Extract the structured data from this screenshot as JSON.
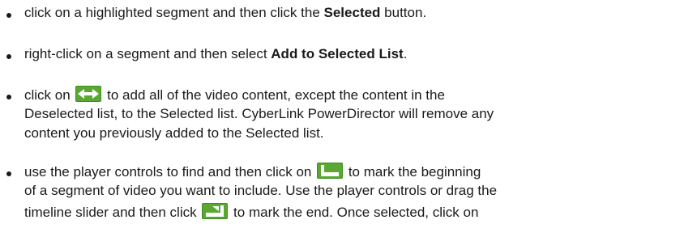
{
  "items": [
    {
      "pre": "click on a highlighted segment and then click the ",
      "bold": "Selected",
      "post": " button."
    },
    {
      "pre": "right-click on a segment and then select ",
      "bold": "Add to Selected List",
      "post": "."
    },
    {
      "line1_pre": "click on ",
      "line1_post": " to add all of the video content, except the content in the",
      "line2": "Deselected list, to the Selected list. CyberLink PowerDirector will remove any",
      "line3": "content you previously added to the Selected list."
    },
    {
      "line1_pre": "use the player controls to find and then click on ",
      "line1_post": " to mark the beginning",
      "line2": "of a segment of video you want to include. Use the player controls or drag the",
      "line3_pre": "timeline slider and then click ",
      "line3_post": " to mark the end. Once selected, click on"
    }
  ],
  "icons": {
    "swap": "swap-arrows-icon",
    "mark_in": "mark-in-icon",
    "mark_out": "mark-out-icon"
  },
  "colors": {
    "icon_green": "#3f8f1f",
    "text": "#1a1a1a"
  }
}
